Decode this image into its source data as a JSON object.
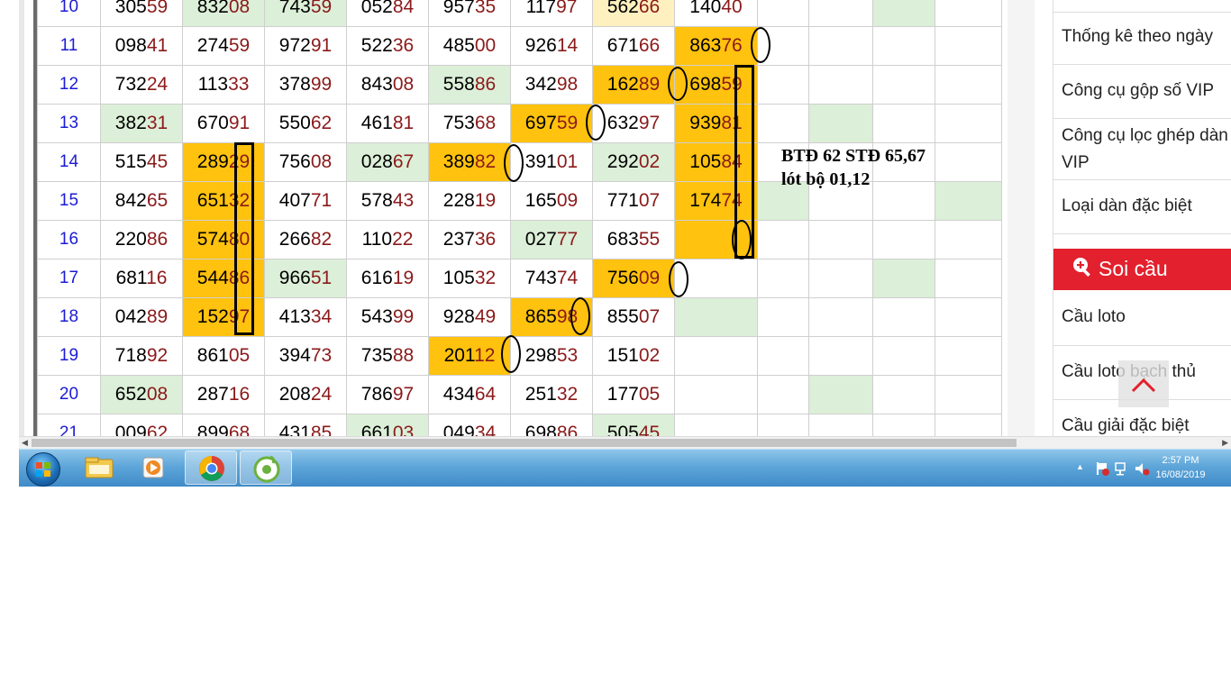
{
  "table": {
    "rows": [
      {
        "idx": "10",
        "cells": [
          {
            "h": "305",
            "t": "59",
            "bg": ""
          },
          {
            "h": "832",
            "t": "08",
            "bg": "g"
          },
          {
            "h": "743",
            "t": "59",
            "bg": "g"
          },
          {
            "h": "052",
            "t": "84",
            "bg": ""
          },
          {
            "h": "957",
            "t": "35",
            "bg": ""
          },
          {
            "h": "117",
            "t": "97",
            "bg": ""
          },
          {
            "h": "562",
            "t": "66",
            "bg": "ly"
          },
          {
            "h": "140",
            "t": "40",
            "bg": ""
          }
        ],
        "extra": [
          "",
          "",
          "g",
          ""
        ]
      },
      {
        "idx": "11",
        "cells": [
          {
            "h": "098",
            "t": "41",
            "bg": ""
          },
          {
            "h": "274",
            "t": "59",
            "bg": ""
          },
          {
            "h": "972",
            "t": "91",
            "bg": ""
          },
          {
            "h": "522",
            "t": "36",
            "bg": ""
          },
          {
            "h": "485",
            "t": "00",
            "bg": ""
          },
          {
            "h": "926",
            "t": "14",
            "bg": ""
          },
          {
            "h": "671",
            "t": "66",
            "bg": ""
          },
          {
            "h": "863",
            "t": "76",
            "bg": "y"
          }
        ],
        "extra": [
          "",
          "",
          "",
          ""
        ]
      },
      {
        "idx": "12",
        "cells": [
          {
            "h": "732",
            "t": "24",
            "bg": ""
          },
          {
            "h": "113",
            "t": "33",
            "bg": ""
          },
          {
            "h": "378",
            "t": "99",
            "bg": ""
          },
          {
            "h": "843",
            "t": "08",
            "bg": ""
          },
          {
            "h": "558",
            "t": "86",
            "bg": "g"
          },
          {
            "h": "342",
            "t": "98",
            "bg": ""
          },
          {
            "h": "162",
            "t": "89",
            "bg": "y"
          },
          {
            "h": "698",
            "t": "59",
            "bg": "y"
          }
        ],
        "extra": [
          "",
          "",
          "",
          ""
        ]
      },
      {
        "idx": "13",
        "cells": [
          {
            "h": "382",
            "t": "31",
            "bg": "g"
          },
          {
            "h": "670",
            "t": "91",
            "bg": ""
          },
          {
            "h": "550",
            "t": "62",
            "bg": ""
          },
          {
            "h": "461",
            "t": "81",
            "bg": ""
          },
          {
            "h": "753",
            "t": "68",
            "bg": ""
          },
          {
            "h": "697",
            "t": "59",
            "bg": "y"
          },
          {
            "h": "632",
            "t": "97",
            "bg": ""
          },
          {
            "h": "939",
            "t": "81",
            "bg": "y"
          }
        ],
        "extra": [
          "",
          "g",
          "",
          ""
        ]
      },
      {
        "idx": "14",
        "cells": [
          {
            "h": "515",
            "t": "45",
            "bg": ""
          },
          {
            "h": "289",
            "t": "29",
            "bg": "y"
          },
          {
            "h": "756",
            "t": "08",
            "bg": ""
          },
          {
            "h": "028",
            "t": "67",
            "bg": "g"
          },
          {
            "h": "389",
            "t": "82",
            "bg": "y"
          },
          {
            "h": "391",
            "t": "01",
            "bg": ""
          },
          {
            "h": "292",
            "t": "02",
            "bg": "g"
          },
          {
            "h": "105",
            "t": "84",
            "bg": "y"
          }
        ],
        "extra": [
          "",
          "",
          "",
          ""
        ]
      },
      {
        "idx": "15",
        "cells": [
          {
            "h": "842",
            "t": "65",
            "bg": ""
          },
          {
            "h": "651",
            "t": "32",
            "bg": "y"
          },
          {
            "h": "407",
            "t": "71",
            "bg": ""
          },
          {
            "h": "578",
            "t": "43",
            "bg": ""
          },
          {
            "h": "228",
            "t": "19",
            "bg": ""
          },
          {
            "h": "165",
            "t": "09",
            "bg": ""
          },
          {
            "h": "771",
            "t": "07",
            "bg": ""
          },
          {
            "h": "174",
            "t": "74",
            "bg": "y"
          }
        ],
        "extra": [
          "g",
          "",
          "",
          "g"
        ]
      },
      {
        "idx": "16",
        "cells": [
          {
            "h": "220",
            "t": "86",
            "bg": ""
          },
          {
            "h": "574",
            "t": "80",
            "bg": "y"
          },
          {
            "h": "266",
            "t": "82",
            "bg": ""
          },
          {
            "h": "110",
            "t": "22",
            "bg": ""
          },
          {
            "h": "237",
            "t": "36",
            "bg": ""
          },
          {
            "h": "027",
            "t": "77",
            "bg": "g"
          },
          {
            "h": "683",
            "t": "55",
            "bg": ""
          },
          {
            "h": "",
            "t": "",
            "bg": "y"
          }
        ],
        "extra": [
          "",
          "",
          "",
          ""
        ]
      },
      {
        "idx": "17",
        "cells": [
          {
            "h": "681",
            "t": "16",
            "bg": ""
          },
          {
            "h": "544",
            "t": "86",
            "bg": "y"
          },
          {
            "h": "966",
            "t": "51",
            "bg": "g"
          },
          {
            "h": "616",
            "t": "19",
            "bg": ""
          },
          {
            "h": "105",
            "t": "32",
            "bg": ""
          },
          {
            "h": "743",
            "t": "74",
            "bg": ""
          },
          {
            "h": "756",
            "t": "09",
            "bg": "y"
          },
          {
            "h": "",
            "t": "",
            "bg": ""
          }
        ],
        "extra": [
          "",
          "",
          "g",
          ""
        ]
      },
      {
        "idx": "18",
        "cells": [
          {
            "h": "042",
            "t": "89",
            "bg": ""
          },
          {
            "h": "152",
            "t": "97",
            "bg": "y"
          },
          {
            "h": "413",
            "t": "34",
            "bg": ""
          },
          {
            "h": "543",
            "t": "99",
            "bg": ""
          },
          {
            "h": "928",
            "t": "49",
            "bg": ""
          },
          {
            "h": "865",
            "t": "98",
            "bg": "y"
          },
          {
            "h": "855",
            "t": "07",
            "bg": ""
          },
          {
            "h": "",
            "t": "",
            "bg": "g"
          }
        ],
        "extra": [
          "",
          "",
          "",
          ""
        ]
      },
      {
        "idx": "19",
        "cells": [
          {
            "h": "718",
            "t": "92",
            "bg": ""
          },
          {
            "h": "861",
            "t": "05",
            "bg": ""
          },
          {
            "h": "394",
            "t": "73",
            "bg": ""
          },
          {
            "h": "735",
            "t": "88",
            "bg": ""
          },
          {
            "h": "201",
            "t": "12",
            "bg": "y"
          },
          {
            "h": "298",
            "t": "53",
            "bg": ""
          },
          {
            "h": "151",
            "t": "02",
            "bg": ""
          },
          {
            "h": "",
            "t": "",
            "bg": ""
          }
        ],
        "extra": [
          "",
          "",
          "",
          ""
        ]
      },
      {
        "idx": "20",
        "cells": [
          {
            "h": "652",
            "t": "08",
            "bg": "g"
          },
          {
            "h": "287",
            "t": "16",
            "bg": ""
          },
          {
            "h": "208",
            "t": "24",
            "bg": ""
          },
          {
            "h": "786",
            "t": "97",
            "bg": ""
          },
          {
            "h": "434",
            "t": "64",
            "bg": ""
          },
          {
            "h": "251",
            "t": "32",
            "bg": ""
          },
          {
            "h": "177",
            "t": "05",
            "bg": ""
          },
          {
            "h": "",
            "t": "",
            "bg": ""
          }
        ],
        "extra": [
          "",
          "g",
          "",
          ""
        ]
      },
      {
        "idx": "21",
        "cells": [
          {
            "h": "009",
            "t": "62",
            "bg": ""
          },
          {
            "h": "899",
            "t": "68",
            "bg": ""
          },
          {
            "h": "431",
            "t": "85",
            "bg": ""
          },
          {
            "h": "661",
            "t": "03",
            "bg": "g"
          },
          {
            "h": "049",
            "t": "34",
            "bg": ""
          },
          {
            "h": "698",
            "t": "86",
            "bg": ""
          },
          {
            "h": "505",
            "t": "45",
            "bg": "g"
          },
          {
            "h": "",
            "t": "",
            "bg": ""
          }
        ],
        "extra": [
          "",
          "",
          "",
          ""
        ]
      }
    ]
  },
  "annotation": {
    "line1": "BTĐ 62 STĐ 65,67",
    "line2": "lót bộ 01,12"
  },
  "sidebar": {
    "items_top": [
      {
        "label": "Thống kê theo ngày"
      },
      {
        "label": "Công cụ gộp số VIP"
      },
      {
        "label": "Công cụ lọc ghép dàn VIP"
      },
      {
        "label": "Loại dàn đặc biệt"
      }
    ],
    "soicau_title": "Soi cầu",
    "items_bottom": [
      {
        "label": "Cầu loto"
      },
      {
        "label": "Cầu loto bạch thủ"
      },
      {
        "label": "Cầu giải đặc biệt"
      }
    ]
  },
  "taskbar": {
    "apps": [
      {
        "icon": "explorer-icon"
      },
      {
        "icon": "media-player-icon"
      },
      {
        "icon": "chrome-icon",
        "active": true
      },
      {
        "icon": "coccoc-icon",
        "active": true
      }
    ],
    "clock_time": "2:57 PM",
    "clock_date": "16/08/2019"
  },
  "colors": {
    "highlight_yellow": "#ffc20e",
    "highlight_green": "#dcefd8",
    "soicau_red": "#e3202d",
    "row_index_blue": "#1b1bd6",
    "tail_red": "#8b1a1a"
  }
}
